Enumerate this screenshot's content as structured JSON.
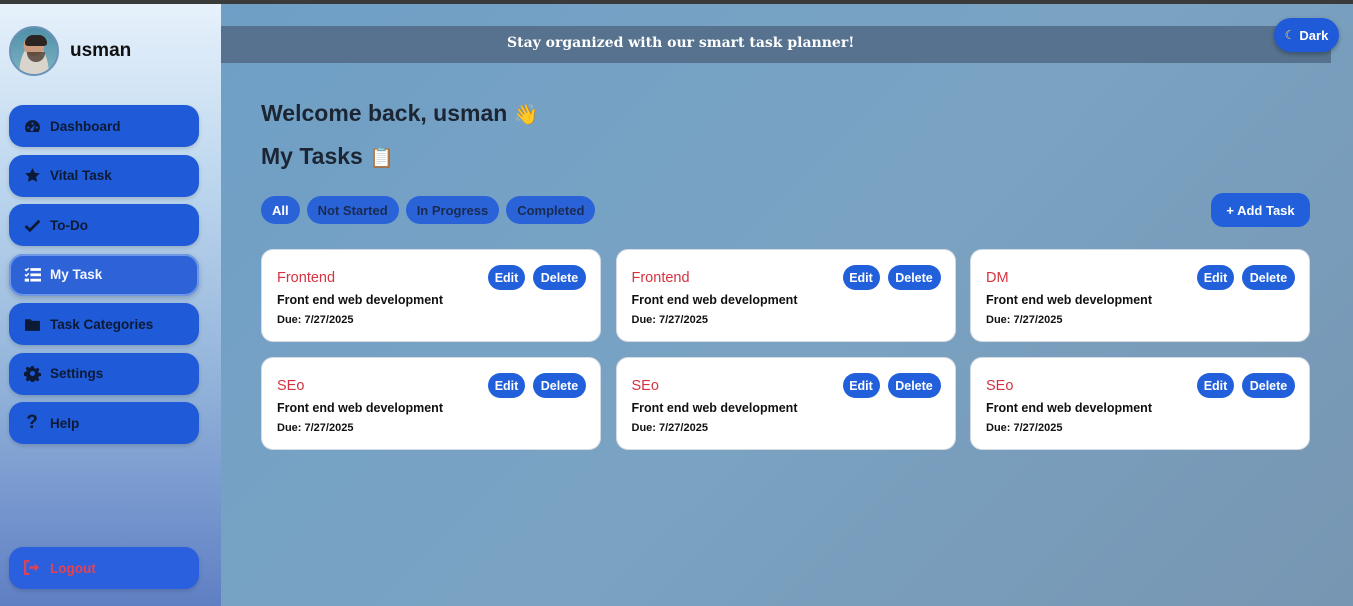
{
  "profile": {
    "username": "usman"
  },
  "sidebar": {
    "items": [
      {
        "label": "Dashboard",
        "icon": "gauge-icon"
      },
      {
        "label": "Vital Task",
        "icon": "star-icon"
      },
      {
        "label": "To-Do",
        "icon": "check-icon"
      },
      {
        "label": "My Task",
        "icon": "list-check-icon",
        "active": true
      },
      {
        "label": "Task Categories",
        "icon": "folder-icon"
      },
      {
        "label": "Settings",
        "icon": "gear-icon"
      },
      {
        "label": "Help",
        "icon": "question-icon"
      }
    ],
    "logout_label": "Logout"
  },
  "banner": {
    "text": "Stay organized with our smart task planner!"
  },
  "theme_toggle": {
    "label": "Dark",
    "icon": "moon-icon"
  },
  "main": {
    "welcome": "Welcome back, usman",
    "welcome_emoji": "👋",
    "section_title": "My Tasks",
    "section_emoji": "📋",
    "filters": [
      "All",
      "Not Started",
      "In Progress",
      "Completed"
    ],
    "active_filter": "All",
    "add_task_label": "+ Add Task",
    "tasks": [
      {
        "title": "Frontend",
        "description": "Front end web development",
        "due": "Due: 7/27/2025"
      },
      {
        "title": "Frontend",
        "description": "Front end web development",
        "due": "Due: 7/27/2025"
      },
      {
        "title": "DM",
        "description": "Front end web development",
        "due": "Due: 7/27/2025"
      },
      {
        "title": "SEo",
        "description": "Front end web development",
        "due": "Due: 7/27/2025"
      },
      {
        "title": "SEo",
        "description": "Front end web development",
        "due": "Due: 7/27/2025"
      },
      {
        "title": "SEo",
        "description": "Front end web development",
        "due": "Due: 7/27/2025"
      }
    ],
    "edit_label": "Edit",
    "delete_label": "Delete"
  },
  "colors": {
    "accent": "#2260db",
    "task_title": "#d6323f",
    "logout_text": "#e8404f",
    "banner_bg": "#56728e"
  }
}
